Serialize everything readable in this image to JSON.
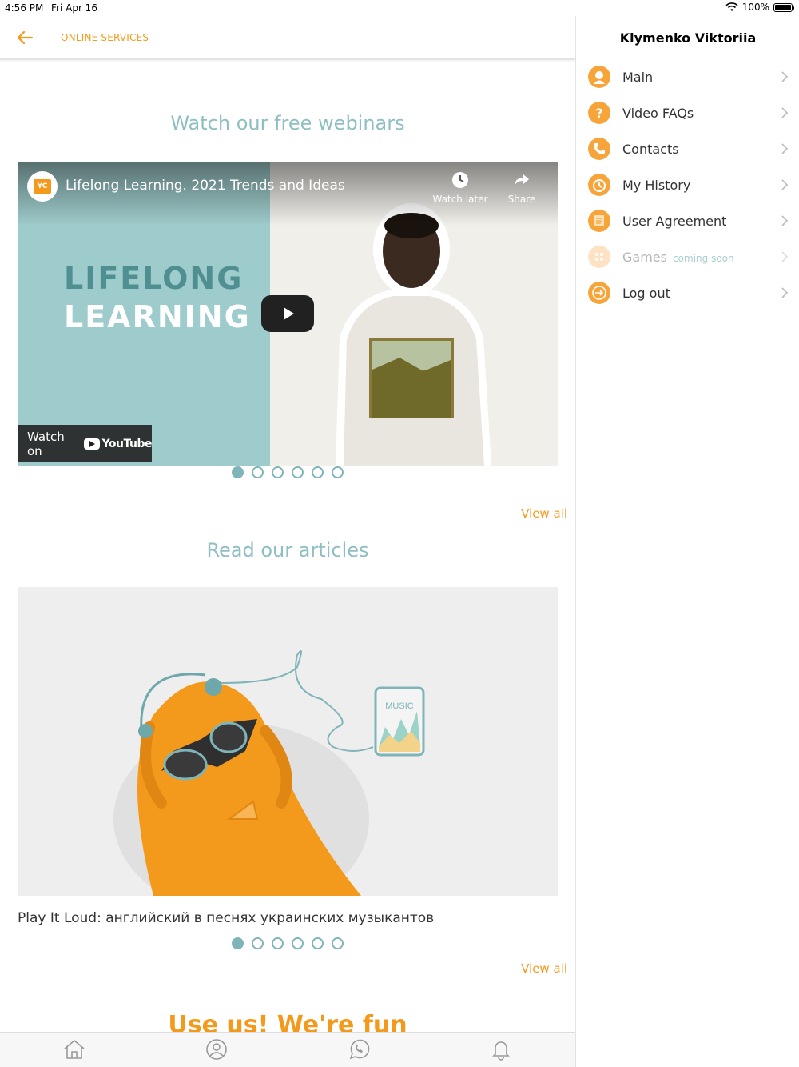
{
  "status": {
    "time": "4:56 PM",
    "date": "Fri Apr 16",
    "battery": "100%"
  },
  "header": {
    "title": "ONLINE SERVICES"
  },
  "webinars": {
    "title": "Watch our free webinars",
    "video_title": "Lifelong Learning. 2021 Trends and Ideas",
    "logo_text": "YC",
    "headline_line1": "LIFELONG",
    "headline_line2": "LEARNING",
    "watch_later": "Watch later",
    "share": "Share",
    "watch_on": "Watch on",
    "youtube": "YouTube",
    "view_all": "View all",
    "pages": 6,
    "active_page": 0
  },
  "articles": {
    "title": "Read our articles",
    "caption": "Play It Loud: английский в песнях украинских музыкантов",
    "music_label": "MUSIC",
    "view_all": "View all",
    "pages": 6,
    "active_page": 0
  },
  "promo": {
    "title": "Use us! We're fun"
  },
  "drawer": {
    "user_name": "Klymenko Viktoriia",
    "items": [
      {
        "label": "Main",
        "icon": "user-icon"
      },
      {
        "label": "Video FAQs",
        "icon": "question-icon"
      },
      {
        "label": "Contacts",
        "icon": "phone-icon"
      },
      {
        "label": "My History",
        "icon": "clock-icon"
      },
      {
        "label": "User Agreement",
        "icon": "document-icon"
      },
      {
        "label": "Games",
        "icon": "dice-icon",
        "badge": "coming soon"
      },
      {
        "label": "Log out",
        "icon": "logout-icon"
      }
    ]
  },
  "colors": {
    "accent": "#f39a1c",
    "teal": "#8fbfc2"
  }
}
